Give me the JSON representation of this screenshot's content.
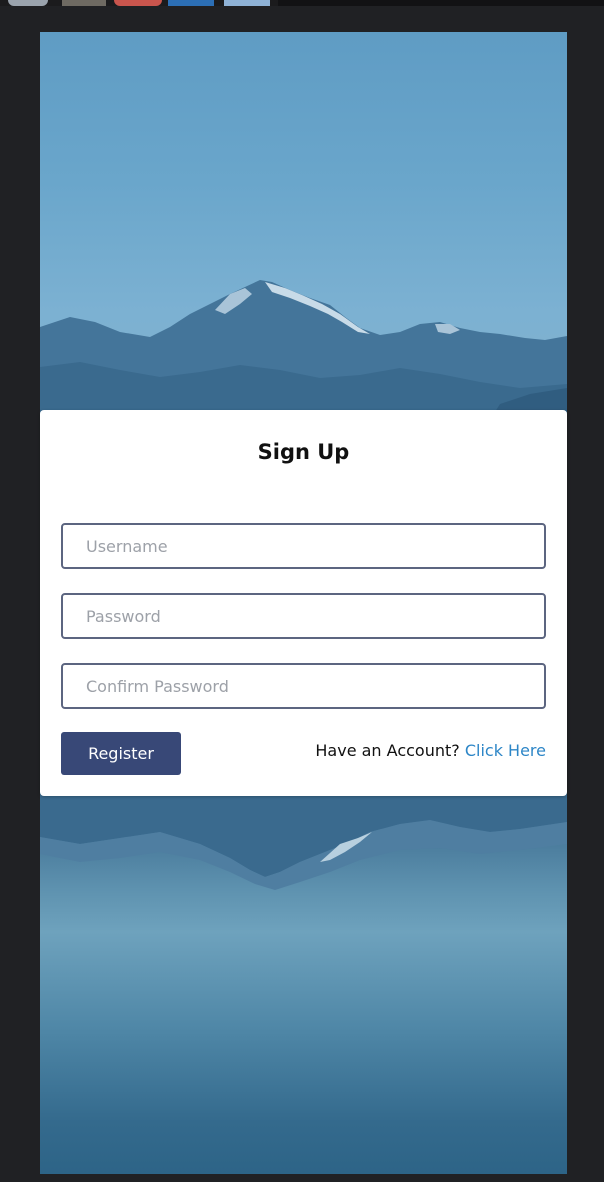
{
  "signup": {
    "title": "Sign Up",
    "username_placeholder": "Username",
    "password_placeholder": "Password",
    "confirm_password_placeholder": "Confirm Password",
    "register_label": "Register",
    "account_prompt": "Have an Account?",
    "login_link": "Click Here"
  },
  "colors": {
    "button": "#384877",
    "link": "#2d86c7",
    "input_border": "#5c6580",
    "backdrop": "#202124"
  }
}
